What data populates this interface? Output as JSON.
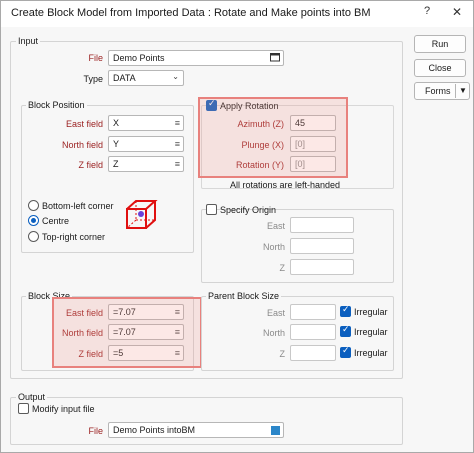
{
  "window": {
    "title": "Create Block Model from Imported Data : Rotate and Make points into BM",
    "help_glyph": "?",
    "close_glyph": "✕"
  },
  "buttons": {
    "run": "Run",
    "close": "Close",
    "forms": "Forms"
  },
  "input_group": {
    "label": "Input",
    "file_label": "File",
    "file_value": "Demo Points",
    "type_label": "Type",
    "type_value": "DATA"
  },
  "block_position": {
    "label": "Block Position",
    "east_label": "East field",
    "east_value": "X",
    "north_label": "North field",
    "north_value": "Y",
    "z_label": "Z field",
    "z_value": "Z",
    "options": [
      "Bottom-left corner",
      "Centre",
      "Top-right corner"
    ],
    "selected_option": "Centre"
  },
  "rotation": {
    "apply_label": "Apply Rotation",
    "apply_checked": true,
    "azimuth_label": "Azimuth (Z)",
    "azimuth_value": "45",
    "plunge_label": "Plunge (X)",
    "plunge_value": "[0]",
    "rotation_label": "Rotation (Y)",
    "rotation_value": "[0]",
    "note": "All rotations are left-handed"
  },
  "origin": {
    "specify_label": "Specify Origin",
    "specify_checked": false,
    "east_label": "East",
    "north_label": "North",
    "z_label": "Z"
  },
  "block_size": {
    "label": "Block Size",
    "east_label": "East field",
    "east_value": "=7.07",
    "north_label": "North field",
    "north_value": "=7.07",
    "z_label": "Z field",
    "z_value": "=5"
  },
  "parent_block_size": {
    "label": "Parent Block Size",
    "east_label": "East",
    "north_label": "North",
    "z_label": "Z",
    "irregular_label": "Irregular",
    "irregular_checked": [
      true,
      true,
      true
    ]
  },
  "output": {
    "label": "Output",
    "modify_label": "Modify input file",
    "modify_checked": false,
    "file_label": "File",
    "file_value": "Demo Points intoBM"
  },
  "colors": {
    "highlight": "#e8817d",
    "accent": "#0b5fbf",
    "field_label_red": "#9a1f1f",
    "cube_red": "#e01010"
  }
}
